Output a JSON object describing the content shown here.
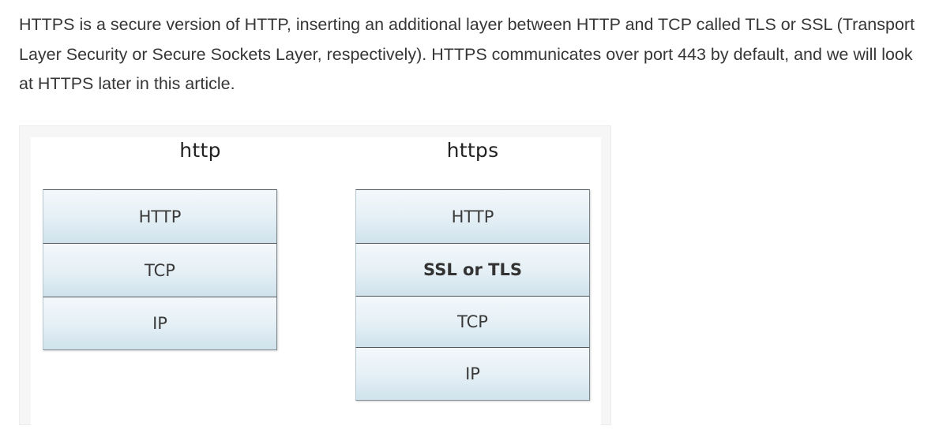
{
  "article": {
    "paragraph": "HTTPS is a secure version of HTTP, inserting an additional layer between HTTP and TCP called TLS or SSL (Transport Layer Security or Secure Sockets Layer, respectively). HTTPS communicates over port 443 by default, and we will look at HTTPS later in this article."
  },
  "diagram": {
    "left_stack": {
      "title": "http",
      "layers": [
        "HTTP",
        "TCP",
        "IP"
      ]
    },
    "right_stack": {
      "title": "https",
      "layers": [
        "HTTP",
        "SSL or TLS",
        "TCP",
        "IP"
      ],
      "emphasized_layer": "SSL or TLS"
    },
    "colors": {
      "layer_fill_top": "#f3f8fb",
      "layer_fill_bottom": "#cfe2ec",
      "layer_border": "#555a5e"
    }
  }
}
